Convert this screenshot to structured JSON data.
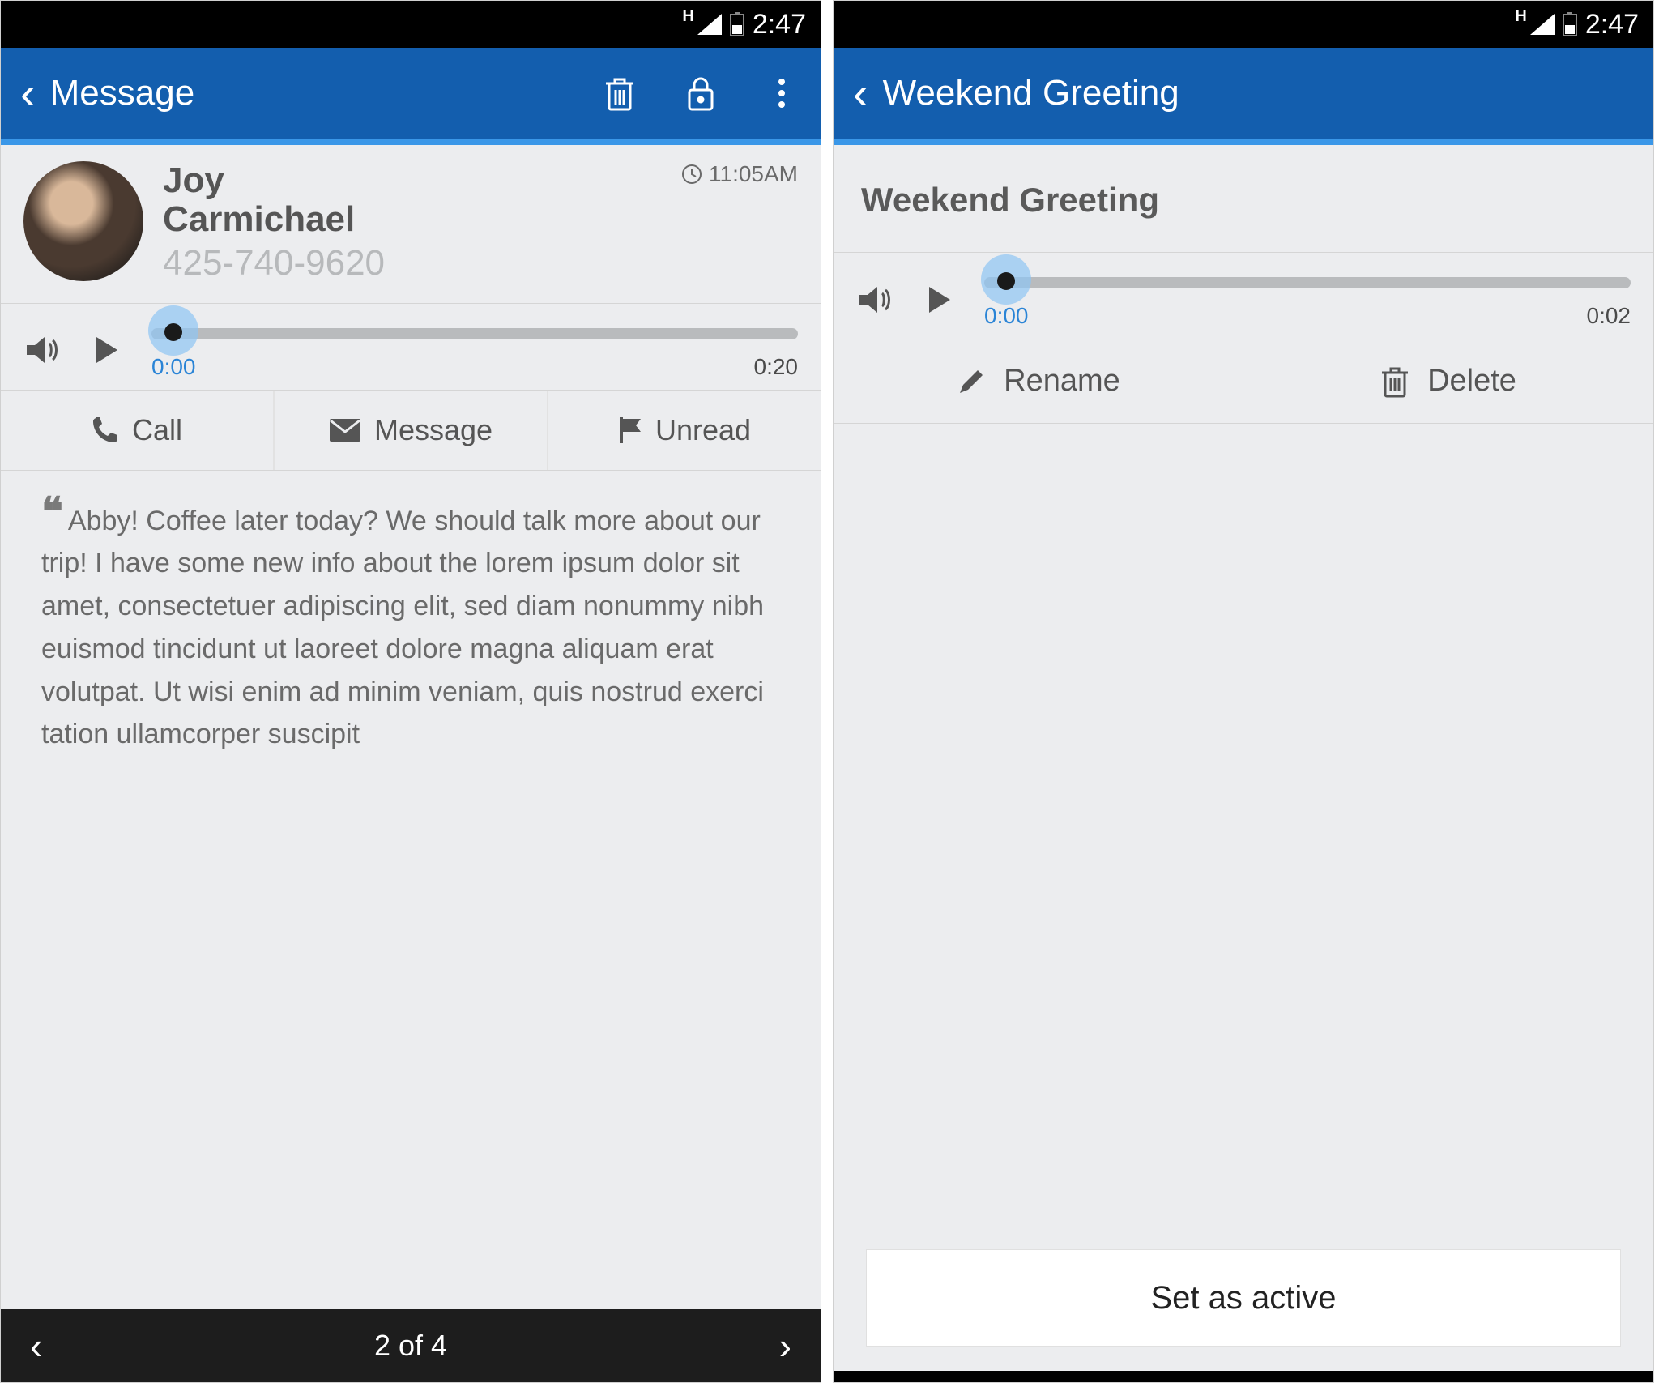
{
  "status": {
    "time": "2:47",
    "network_indicator": "H"
  },
  "left": {
    "appbar_title": "Message",
    "contact": {
      "name_first": "Joy",
      "name_last": "Carmichael",
      "phone": "425-740-9620",
      "time": "11:05AM"
    },
    "player": {
      "current": "0:00",
      "duration": "0:20"
    },
    "actions": {
      "call": "Call",
      "message": "Message",
      "unread": "Unread"
    },
    "transcript": "Abby! Coffee later today? We should talk more about our trip! I have some new info about the lorem ipsum dolor sit amet, consectetuer adipiscing elit, sed diam nonummy nibh euismod tincidunt ut laoreet dolore magna aliquam erat volut­pat. Ut wisi enim ad minim veniam, quis nostrud exerci tation ullamcorper suscipit",
    "pager": "2 of 4"
  },
  "right": {
    "appbar_title": "Weekend Greeting",
    "heading": "Weekend Greeting",
    "player": {
      "current": "0:00",
      "duration": "0:02"
    },
    "actions": {
      "rename": "Rename",
      "delete": "Delete"
    },
    "set_active": "Set as active"
  }
}
